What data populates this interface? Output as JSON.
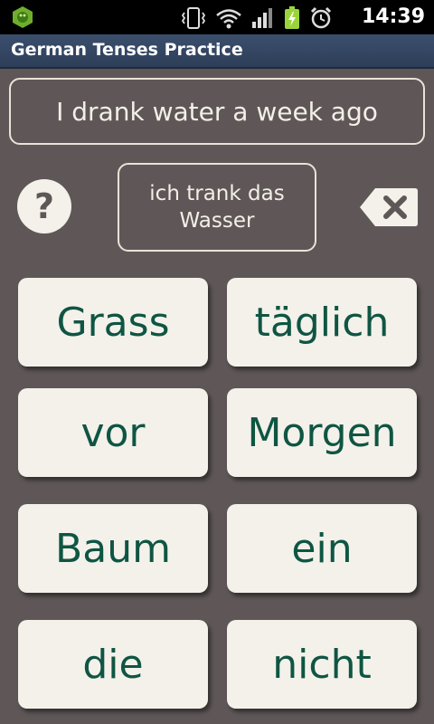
{
  "status_bar": {
    "time": "14:39"
  },
  "title_bar": {
    "title": "German Tenses Practice"
  },
  "prompt": {
    "text": "I drank water a week ago"
  },
  "help": {
    "label": "?"
  },
  "answer": {
    "text": "ich trank das Wasser"
  },
  "words": [
    "Grass",
    "täglich",
    "vor",
    "Morgen",
    "Baum",
    "ein",
    "die",
    "nicht"
  ],
  "colors": {
    "background": "#5f5757",
    "button_face": "#f3f1ea",
    "word_text": "#0f5543",
    "title_bar": "#3b4f6e"
  }
}
